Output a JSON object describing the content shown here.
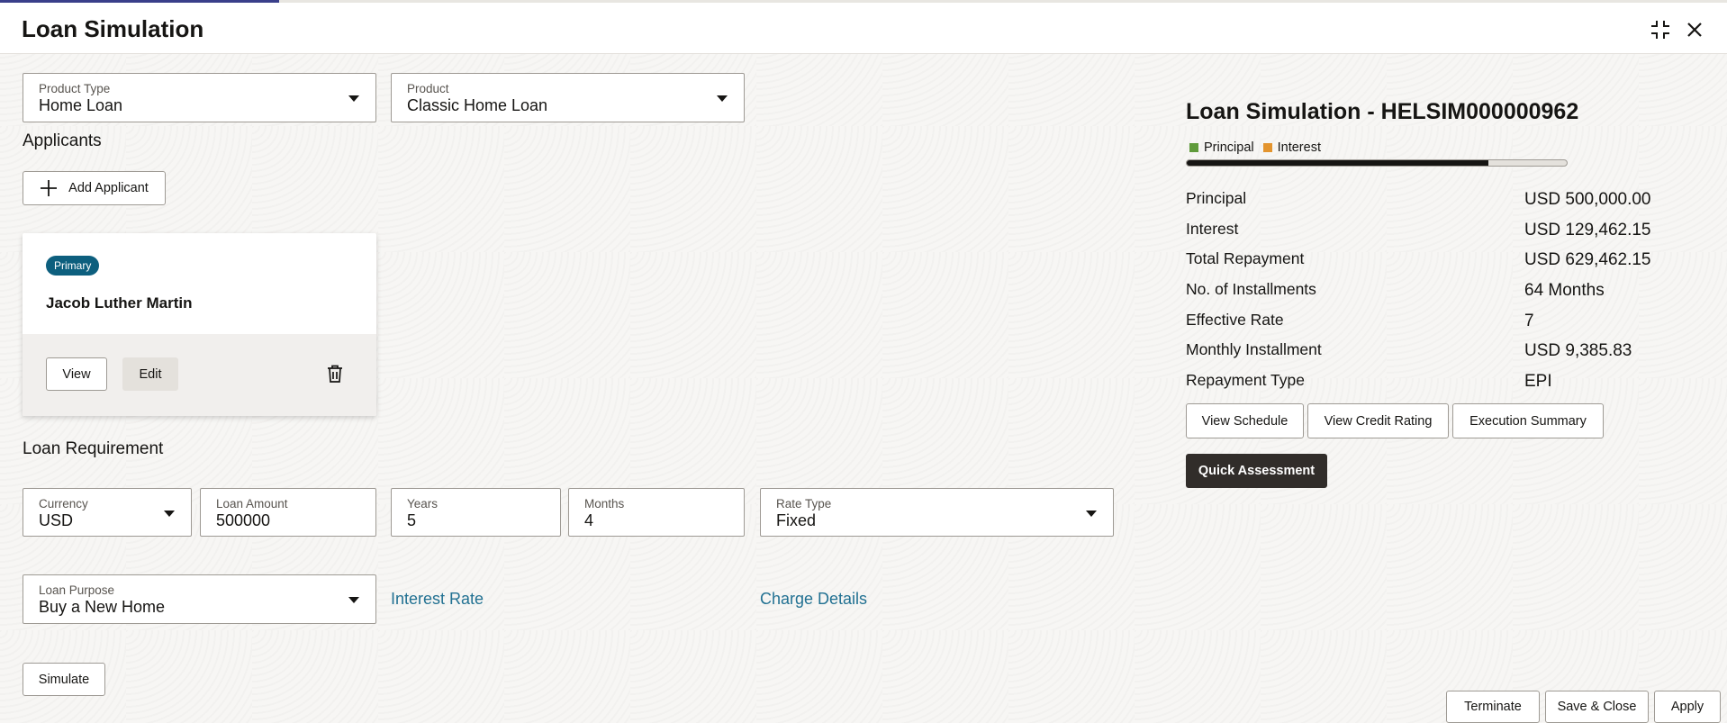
{
  "header": {
    "title": "Loan Simulation"
  },
  "product_type": {
    "label": "Product Type",
    "value": "Home Loan"
  },
  "product": {
    "label": "Product",
    "value": "Classic Home Loan"
  },
  "applicants": {
    "title": "Applicants",
    "add_label": "Add Applicant",
    "card": {
      "badge": "Primary",
      "name": "Jacob Luther Martin",
      "view_label": "View",
      "edit_label": "Edit"
    }
  },
  "loan_requirement": {
    "title": "Loan Requirement",
    "currency": {
      "label": "Currency",
      "value": "USD"
    },
    "loan_amount": {
      "label": "Loan Amount",
      "value": "500000"
    },
    "years": {
      "label": "Years",
      "value": "5"
    },
    "months": {
      "label": "Months",
      "value": "4"
    },
    "rate_type": {
      "label": "Rate Type",
      "value": "Fixed"
    },
    "loan_purpose": {
      "label": "Loan Purpose",
      "value": "Buy a New Home"
    },
    "interest_rate_link": "Interest Rate",
    "charge_details_link": "Charge Details",
    "simulate_label": "Simulate"
  },
  "summary": {
    "title": "Loan Simulation - HELSIM000000962",
    "legend": [
      {
        "label": "Principal",
        "color": "#5f9a3a"
      },
      {
        "label": "Interest",
        "color": "#e3942e"
      }
    ],
    "principal_fraction": 0.794,
    "rows": [
      {
        "label": "Principal",
        "value": "USD 500,000.00"
      },
      {
        "label": "Interest",
        "value": "USD 129,462.15"
      },
      {
        "label": "Total Repayment",
        "value": "USD 629,462.15"
      },
      {
        "label": "No. of Installments",
        "value": "64 Months"
      },
      {
        "label": "Effective Rate",
        "value": "7"
      },
      {
        "label": "Monthly Installment",
        "value": "USD 9,385.83"
      },
      {
        "label": "Repayment Type",
        "value": "EPI"
      }
    ],
    "view_schedule": "View Schedule",
    "view_credit_rating": "View Credit Rating",
    "execution_summary": "Execution Summary",
    "quick_assessment": "Quick Assessment"
  },
  "footer": {
    "terminate": "Terminate",
    "save_close": "Save & Close",
    "apply": "Apply"
  }
}
